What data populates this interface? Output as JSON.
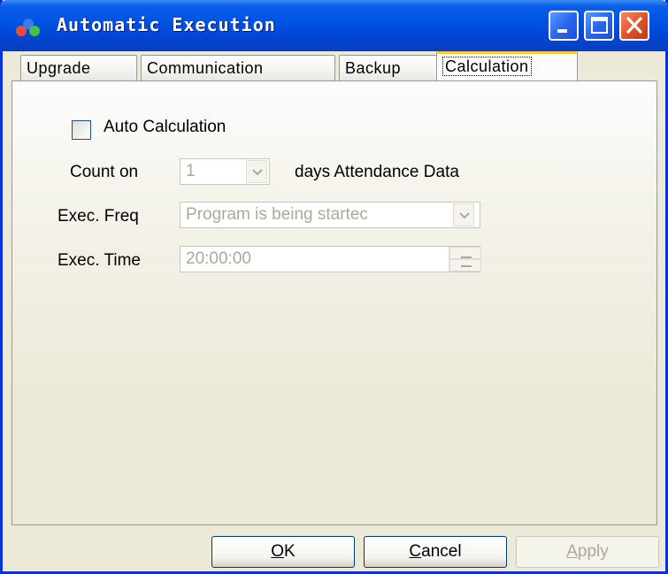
{
  "window": {
    "title": "Automatic Execution"
  },
  "tabs": [
    {
      "label": "Upgrade",
      "active": false
    },
    {
      "label": "Communication",
      "active": false
    },
    {
      "label": "Backup",
      "active": false
    },
    {
      "label": "Calculation",
      "active": true
    }
  ],
  "calculation": {
    "auto_calc_label": "Auto Calculation",
    "auto_calc_checked": false,
    "count_on_label": "Count on",
    "count_on_value": "1",
    "days_label": "days Attendance Data",
    "exec_freq_label": "Exec. Freq",
    "exec_freq_value": "Program is being startec",
    "exec_time_label": "Exec. Time",
    "exec_time_value": "20:00:00"
  },
  "buttons": {
    "ok": {
      "accel": "O",
      "rest": "K"
    },
    "cancel": {
      "accel": "C",
      "rest": "ancel"
    },
    "apply": {
      "accel": "A",
      "rest": "pply"
    }
  },
  "icons": [
    "app-icon",
    "minimize-icon",
    "maximize-icon",
    "close-icon",
    "chevron-down-icon",
    "spin-up-icon",
    "spin-down-icon"
  ],
  "colors": {
    "titlebar": "#0054e3",
    "window_bg": "#ece9d8",
    "close_button": "#e0552c",
    "active_tab_highlight": "#ffc83c",
    "disabled_text": "#aca899"
  }
}
